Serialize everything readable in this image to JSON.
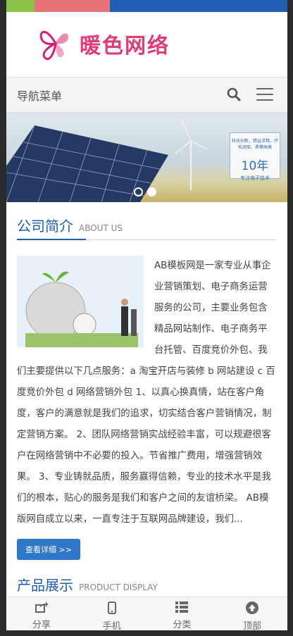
{
  "header": {
    "logo_text": "暖色网络"
  },
  "nav": {
    "title": "导航菜单"
  },
  "banner": {
    "badge_small": "科技创新，精益求精，开拓进取，勇攀高峰",
    "badge_big": "10年",
    "badge_sub": "专注电子技术",
    "slides_total": 2,
    "active_slide": 2
  },
  "about": {
    "title": "公司简介",
    "subtitle": "ABOUT US",
    "text": "AB模板网是一家专业从事企业营销策划、电子商务运营服务的公司，主要业务包含精品网站制作、电子商务平台托管、百度竞价外包、我们主要提供以下几点服务：a 淘宝开店与装修 b 网站建设 c 百度竞价外包 d 网络营销外包 1、以真心换真情，站在客户角度，客户的满意就是我们的追求，切实结合客户营销情况，制定营销方案。 2、团队网络营销实战经验丰富，可以规避很客户在网络营销中不必要的投入。节省推广费用，增强营销效果。 3、专业铸就品质，服务赢得信赖，专业的技术水平是我们的根本，贴心的服务是我们和客户之间的友谊桥梁。 AB模版网自成立以来，一直专注于互联网品牌建设，我们...",
    "more_label": "查看详细 >>"
  },
  "products": {
    "title": "产品展示",
    "subtitle": "PRODUCT DISPLAY"
  },
  "footer": {
    "items": [
      {
        "label": "分享",
        "icon": "share-icon"
      },
      {
        "label": "手机",
        "icon": "mobile-icon"
      },
      {
        "label": "分类",
        "icon": "list-icon"
      },
      {
        "label": "顶部",
        "icon": "arrow-up-icon"
      }
    ]
  },
  "colors": {
    "accent": "#1e5fb4",
    "button": "#2f78c9",
    "logo": "#e23b7a"
  }
}
